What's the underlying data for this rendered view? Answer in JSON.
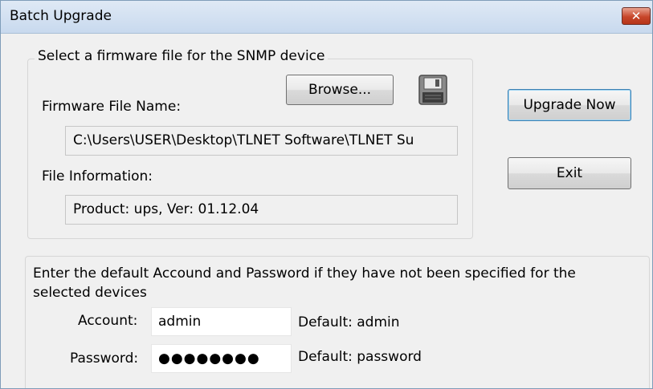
{
  "window": {
    "title": "Batch Upgrade",
    "close_glyph": "✕"
  },
  "firmware_group": {
    "legend": "Select a firmware file for the SNMP device",
    "browse_label": "Browse...",
    "file_name_label": "Firmware File Name:",
    "file_name_value": "C:\\Users\\USER\\Desktop\\TLNET Software\\TLNET Su",
    "file_info_label": "File Information:",
    "file_info_value": "Product: ups, Ver: 01.12.04",
    "floppy_icon": "floppy-disk-icon"
  },
  "actions": {
    "upgrade_label": "Upgrade Now",
    "exit_label": "Exit"
  },
  "credentials": {
    "instruction_line1": "Enter the default Accound and Password if they have not been specified for the",
    "instruction_line2": "selected devices",
    "account_label": "Account:",
    "account_value": "admin",
    "account_default": "Default: admin",
    "password_label": "Password:",
    "password_value": "●●●●●●●●",
    "password_default": "Default: password"
  }
}
